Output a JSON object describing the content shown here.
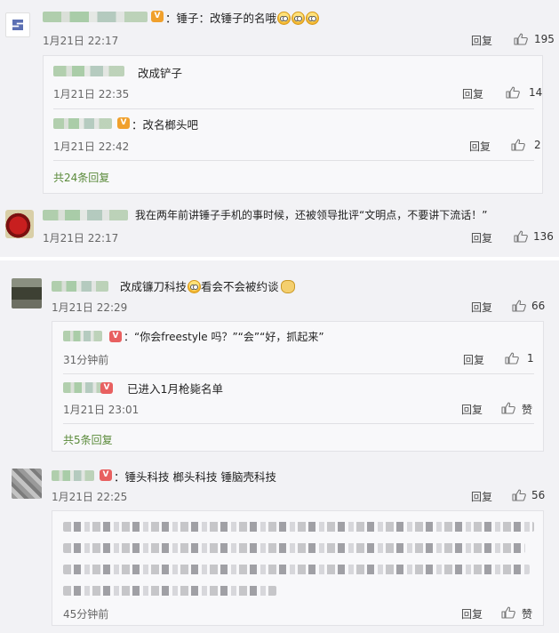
{
  "comments": [
    {
      "text": "：锤子：改锤子的名哦",
      "time": "1月21日 22:17",
      "reply_label": "回复",
      "likes": "195",
      "replies": [
        {
          "text": "改成铲子",
          "time": "1月21日 22:35",
          "reply_label": "回复",
          "likes": "14"
        },
        {
          "text": "：改名榔头吧",
          "time": "1月21日 22:42",
          "reply_label": "回复",
          "likes": "2"
        }
      ],
      "more": "共24条回复"
    },
    {
      "text": "我在两年前讲锤子手机的事时候，还被领导批评“文明点，不要讲下流话！”",
      "time": "1月21日 22:17",
      "reply_label": "回复",
      "likes": "136"
    },
    {
      "text_a": "改成镰刀科技",
      "text_b": "看会不会被约谈",
      "time": "1月21日 22:29",
      "reply_label": "回复",
      "likes": "66",
      "replies": [
        {
          "text": "：“你会freestyle 吗？”“会”“好，抓起来”",
          "time": "31分钟前",
          "reply_label": "回复",
          "likes": "1"
        },
        {
          "text": "已进入1月枪毙名单",
          "time": "1月21日 23:01",
          "reply_label": "回复",
          "likes": "赞"
        }
      ],
      "more": "共5条回复"
    },
    {
      "text": "：锤头科技 榔头科技 锤脑壳科技",
      "time": "1月21日 22:25",
      "reply_label": "回复",
      "likes": "56",
      "replies": [
        {
          "time": "45分钟前",
          "reply_label": "回复",
          "likes": "赞"
        }
      ]
    }
  ],
  "icons": {
    "like": "thumbs-up-icon",
    "verified": "v-badge-icon",
    "emoji": "grimace-emoji-icon"
  },
  "colors": {
    "more_link": "#5a8a3a",
    "badge": "#f0a02c",
    "panel": "#f2f2f5"
  }
}
